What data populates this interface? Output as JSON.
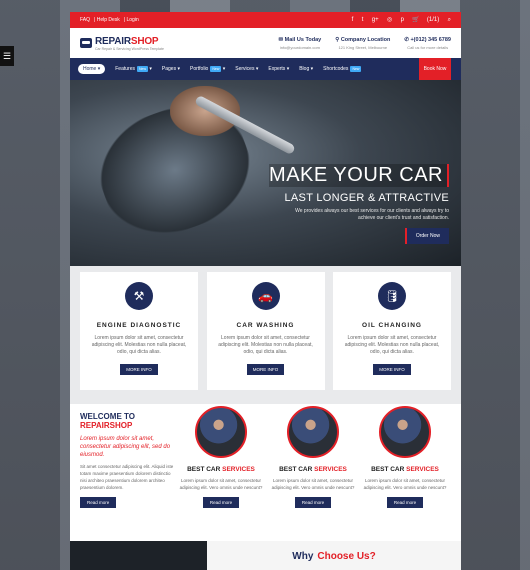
{
  "topbar": {
    "links": [
      "FAQ",
      "Help Desk",
      "Login"
    ],
    "cart": "(1/1)"
  },
  "header": {
    "logo_main": "REPAIR",
    "logo_accent": "SHOP",
    "logo_tag": "Car Repair & Servicing WordPress Template",
    "contacts": [
      {
        "title": "Mail Us Today",
        "sub": "info@yourdomain.com"
      },
      {
        "title": "Company Location",
        "sub": "121 King Street, Melbourne"
      },
      {
        "title": "+(012) 345 6789",
        "sub": "Call us for more details"
      }
    ]
  },
  "nav": {
    "items": [
      {
        "label": "Home",
        "new": ""
      },
      {
        "label": "Features",
        "new": "New"
      },
      {
        "label": "Pages",
        "new": ""
      },
      {
        "label": "Portfolio",
        "new": "New"
      },
      {
        "label": "Services",
        "new": ""
      },
      {
        "label": "Experts",
        "new": ""
      },
      {
        "label": "Blog",
        "new": ""
      },
      {
        "label": "Shortcodes",
        "new": "New"
      }
    ],
    "book": "Book Now"
  },
  "hero": {
    "title": "MAKE YOUR CAR",
    "subtitle": "LAST LONGER & ATTRACTIVE",
    "text": "We provides always our best services for our clients and always try to achieve our client's trust and satisfaction.",
    "button": "Order Now"
  },
  "services": [
    {
      "title": "ENGINE DIAGNOSTIC",
      "text": "Lorem ipsum dolor sit amet, consectetur adipiscing elit. Molestias non nulla placeat, odio, qui dicta alias.",
      "button": "MORE INFO",
      "icon": "engine-icon"
    },
    {
      "title": "CAR WASHING",
      "text": "Lorem ipsum dolor sit amet, consectetur adipiscing elit. Molestias non nulla placeat, odio, qui dicta alias.",
      "button": "MORE INFO",
      "icon": "car-wash-icon"
    },
    {
      "title": "OIL CHANGING",
      "text": "Lorem ipsum dolor sit amet, consectetur adipiscing elit. Molestias non nulla placeat, odio, qui dicta alias.",
      "button": "MORE INFO",
      "icon": "oil-icon"
    }
  ],
  "welcome": {
    "title1": "WELCOME TO",
    "title2": "REPAIRSHOP",
    "quote": "Lorem ipsum dolor sit amet, consectetur adipiscing elit, sed do eiusmod.",
    "text": "Sit amet consectetur adipiscing elit. Aliquid iste totam maxime praesentium dolorem distinctio nisi architeo praesentium dolorem architeo praesentium dolorem.",
    "button": "Read more"
  },
  "best": [
    {
      "title": "BEST CAR",
      "accent": "SERVICES",
      "text": "Lorem ipsum dolor sit amet, consectetur adipiscing elit. Vero omnis unde nescunt?",
      "button": "Read more"
    },
    {
      "title": "BEST CAR",
      "accent": "SERVICES",
      "text": "Lorem ipsum dolor sit amet, consectetur adipiscing elit. Vero omnis unde nescunt?",
      "button": "Read more"
    },
    {
      "title": "BEST CAR",
      "accent": "SERVICES",
      "text": "Lorem ipsum dolor sit amet, consectetur adipiscing elit. Vero omnis unde nescunt?",
      "button": "Read more"
    }
  ],
  "why": {
    "prefix": "Why",
    "accent": "Choose Us?"
  },
  "colors": {
    "brand_navy": "#1f2c5c",
    "brand_red": "#e32027"
  }
}
